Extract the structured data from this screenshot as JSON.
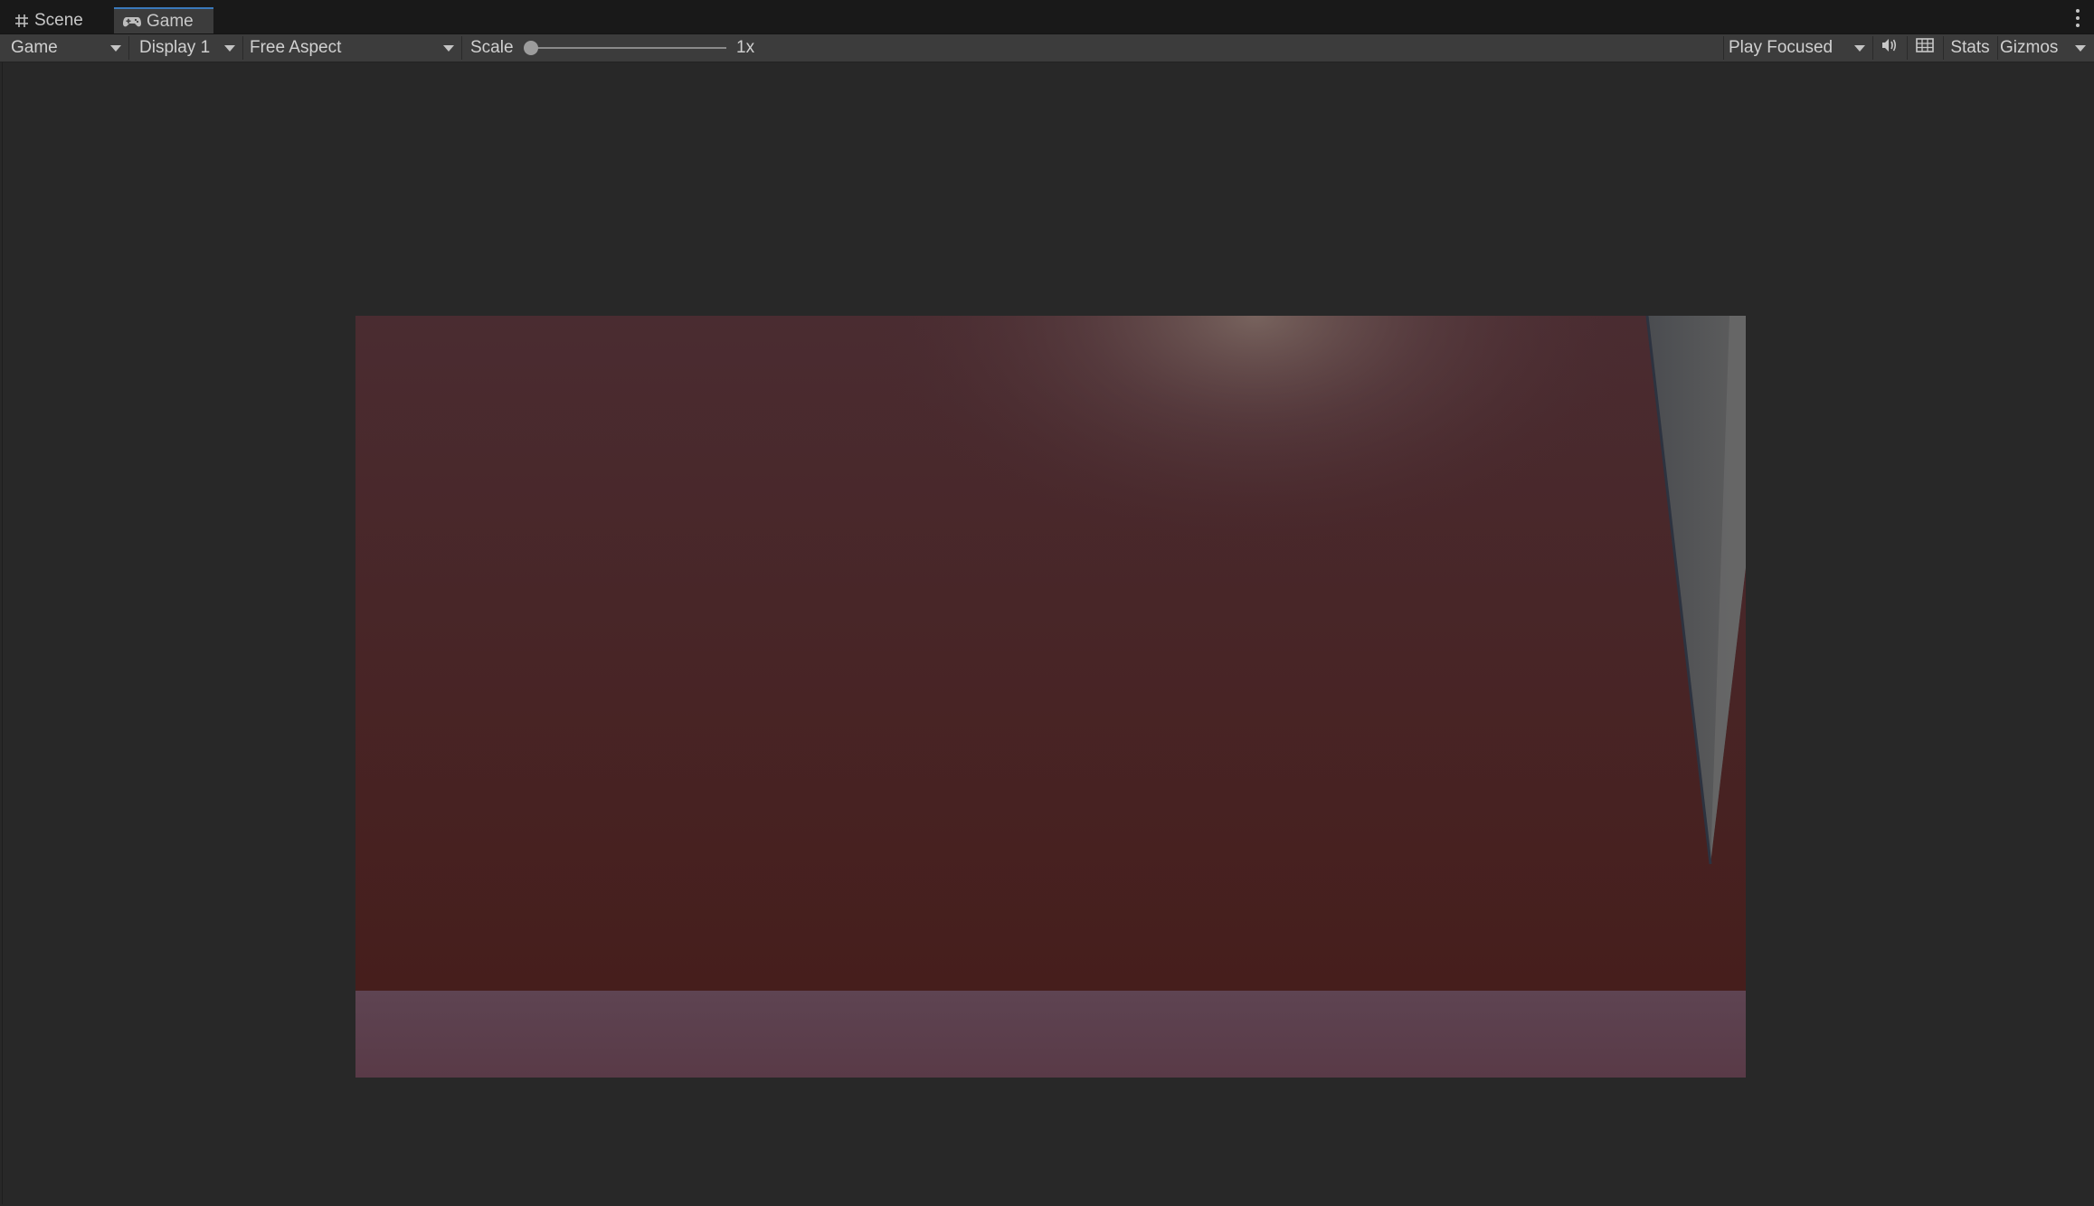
{
  "tabs": [
    {
      "label": "Scene",
      "icon": "grid-icon",
      "active": false
    },
    {
      "label": "Game",
      "icon": "gamepad-icon",
      "active": true
    }
  ],
  "toolbar": {
    "view_mode": "Game",
    "display": "Display 1",
    "aspect": "Free Aspect",
    "scale_label": "Scale",
    "scale_value": "1x",
    "play_mode": "Play Focused",
    "audio_icon": "speaker-icon",
    "grid_icon": "grid-table-icon",
    "stats_label": "Stats",
    "gizmos_label": "Gizmos"
  },
  "game_view": {
    "background_top": "#4a2c31",
    "background_bottom": "#461e1c",
    "floor_color": "#5a3f4d",
    "spike_color": "#5c5c5c",
    "light_color": "#6e5a56"
  }
}
